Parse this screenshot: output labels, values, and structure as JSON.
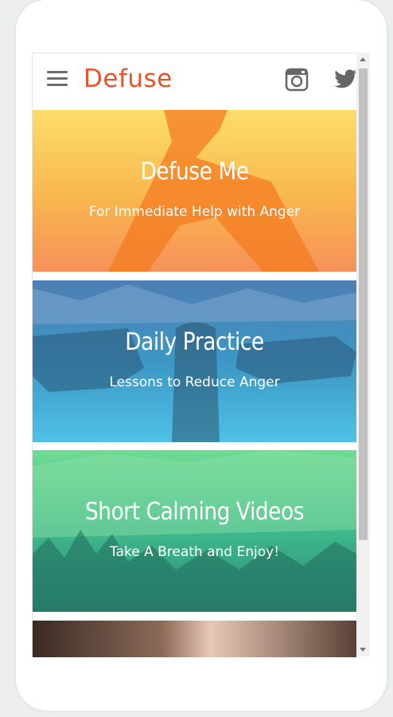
{
  "header": {
    "brand": "Defuse",
    "menu_icon": "hamburger-menu-icon",
    "social_icons": [
      "instagram-icon",
      "twitter-icon"
    ]
  },
  "cards": [
    {
      "title": "Defuse Me",
      "subtitle": "For Immediate Help with Anger"
    },
    {
      "title": "Daily Practice",
      "subtitle": "Lessons to Reduce Anger"
    },
    {
      "title": "Short Calming Videos",
      "subtitle": "Take A Breath and Enjoy!"
    }
  ],
  "colors": {
    "brand": "#e8532a",
    "card1": "#f9b64f",
    "card2": "#3c97c4",
    "card3": "#3fb88b"
  }
}
